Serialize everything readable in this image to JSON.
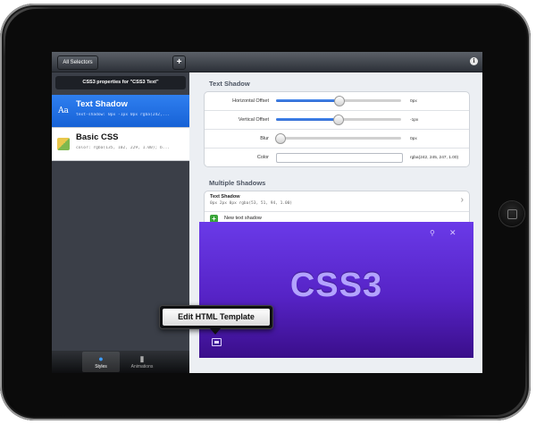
{
  "left_nav": {
    "all_selectors_label": "All Selectors",
    "add_label": "+"
  },
  "properties_header": "CSS3 properties for \"CSS3 Text\"",
  "cells": [
    {
      "icon_glyph": "Aa",
      "title": "Text Shadow",
      "subtitle": "text-shadow: 0px -1px 0px rgba(242,..."
    },
    {
      "title": "Basic CSS",
      "subtitle": "color: rgba(135, 102, 229, 1.00); b..."
    }
  ],
  "tabs": [
    {
      "label": "Styles",
      "icon": "globe-icon"
    },
    {
      "label": "Animations",
      "icon": "film-icon"
    }
  ],
  "text_shadow": {
    "section_title": "Text Shadow",
    "horizontal_offset": {
      "label": "Horizontal Offset",
      "value": "0px",
      "level": 0.5
    },
    "vertical_offset": {
      "label": "Vertical Offset",
      "value": "-1px",
      "level": 0.49
    },
    "blur": {
      "label": "Blur",
      "value": "0px",
      "level": 0.03
    },
    "color": {
      "label": "Color",
      "value": "rgba(242, 245, 247, 1.00)"
    }
  },
  "multiple_shadows": {
    "section_title": "Multiple Shadows",
    "item_title": "Text Shadow",
    "item_value": "0px 2px 0px rgba(53, 51, 94, 1.00)",
    "new_label": "New text shadow"
  },
  "preview": {
    "text": "CSS3"
  },
  "popover": {
    "label": "Edit HTML Template"
  },
  "colors": {
    "accent": "#2f7ff0",
    "preview_top": "#6a3ae8",
    "preview_bottom": "#3a0e8a",
    "css3_text": "#b3a3ff"
  }
}
